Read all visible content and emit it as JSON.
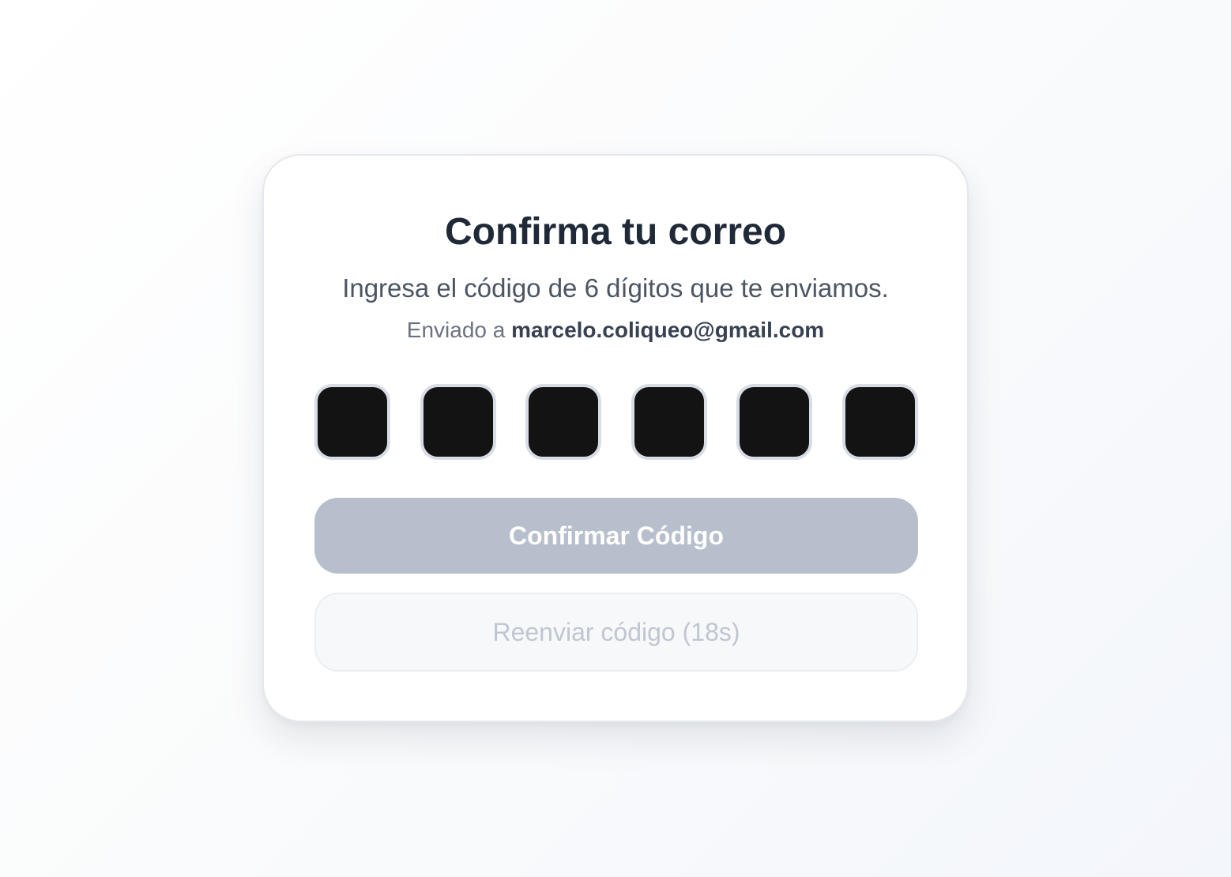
{
  "verification": {
    "title": "Confirma tu correo",
    "subtitle": "Ingresa el código de 6 dígitos que te enviamos.",
    "sent_prefix": "Enviado a",
    "email": "marcelo.coliqueo@gmail.com",
    "code_digits": [
      "",
      "",
      "",
      "",
      "",
      ""
    ],
    "confirm_label": "Confirmar Código",
    "resend_label": "Reenviar código (18s)",
    "confirm_disabled": true,
    "resend_disabled": true
  },
  "colors": {
    "title": "#1f2937",
    "digit_box_fill": "#131313",
    "digit_box_border": "#d7dce6",
    "confirm_disabled_bg": "#b8bfcc",
    "resend_disabled_text": "#c0c6d1"
  }
}
